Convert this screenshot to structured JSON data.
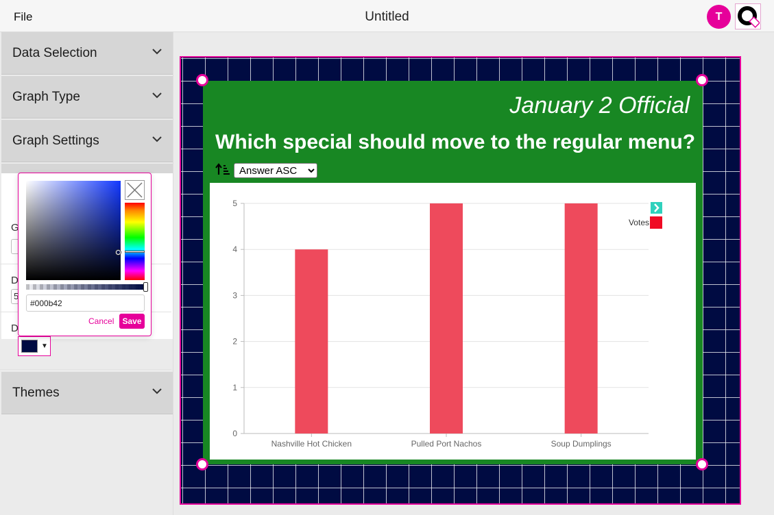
{
  "app": {
    "file_menu": "File",
    "doc_title": "Untitled",
    "user_initial": "T"
  },
  "sidebar": {
    "panels": {
      "data_selection": "Data Selection",
      "graph_type": "Graph Type",
      "graph_settings": "Graph Settings",
      "design_partial": "D",
      "themes": "Themes"
    },
    "fields": [
      {
        "label_partial": "G"
      },
      {
        "label_partial": "D",
        "value_partial": "5"
      },
      {
        "label_partial": "D"
      }
    ],
    "selected_color": "#000b42"
  },
  "color_picker": {
    "hex_value": "#000b42",
    "cancel_label": "Cancel",
    "save_label": "Save",
    "hue_color": "#1238ff"
  },
  "slide": {
    "subtitle": "January 2 Official",
    "question": "Which special should move to the regular menu?",
    "sort_options": [
      "Answer ASC"
    ],
    "sort_selected": "Answer ASC",
    "background_color": "#000b42",
    "card_color": "#188723"
  },
  "chart_data": {
    "type": "bar",
    "categories": [
      "Nashville Hot Chicken",
      "Pulled Port Nachos",
      "Soup Dumplings"
    ],
    "series": [
      {
        "name": "Votes",
        "values": [
          4,
          5,
          5
        ],
        "color": "#ee4a5c"
      }
    ],
    "ylim": [
      0,
      5
    ],
    "yticks": [
      0,
      1,
      2,
      3,
      4,
      5
    ],
    "grid": true,
    "legend": "top-right",
    "legend_swatch_color": "#f00a24"
  }
}
